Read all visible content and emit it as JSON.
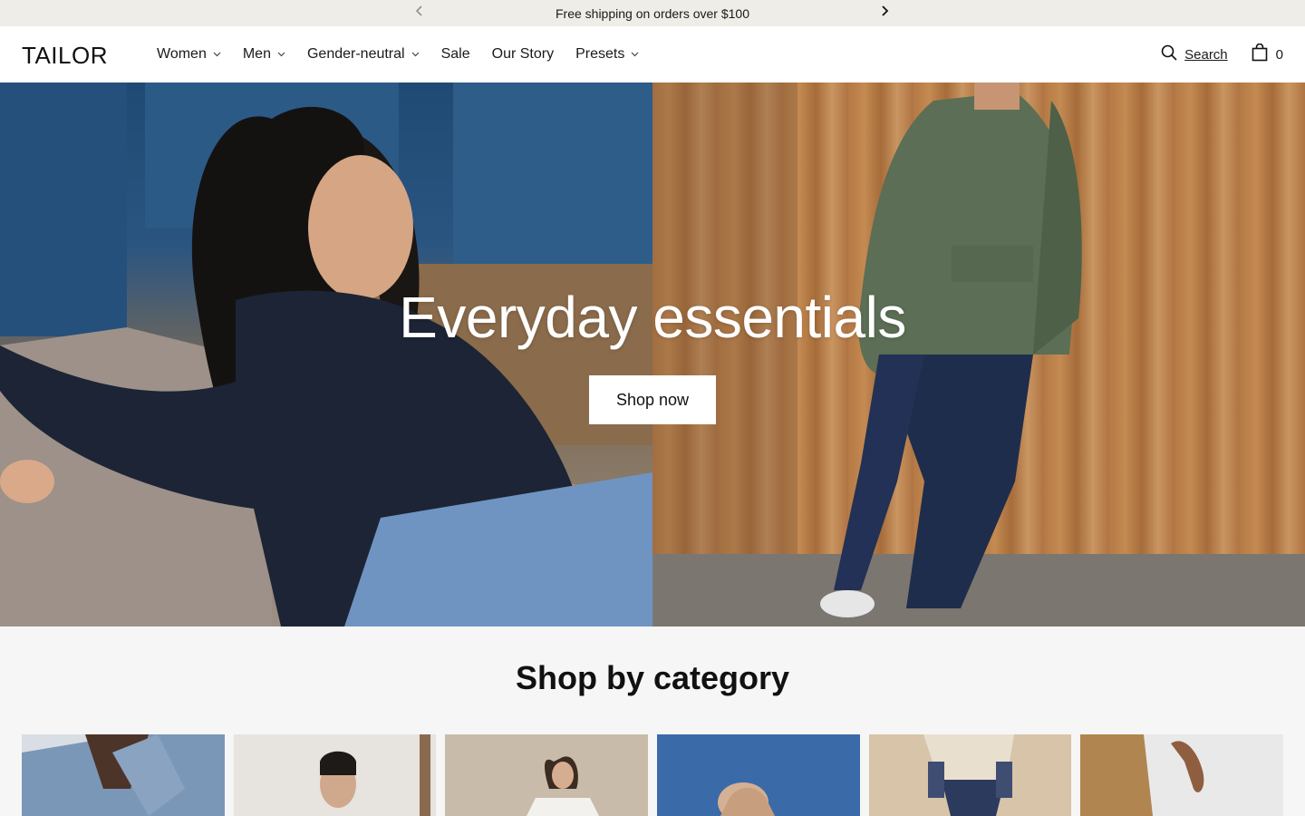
{
  "announcement": {
    "text": "Free shipping on orders over $100",
    "prev_icon": "chevron-left-icon",
    "next_icon": "chevron-right-icon"
  },
  "header": {
    "logo": "TAILOR",
    "nav": [
      {
        "label": "Women",
        "has_dropdown": true
      },
      {
        "label": "Men",
        "has_dropdown": true
      },
      {
        "label": "Gender-neutral",
        "has_dropdown": true
      },
      {
        "label": "Sale",
        "has_dropdown": false
      },
      {
        "label": "Our Story",
        "has_dropdown": false
      },
      {
        "label": "Presets",
        "has_dropdown": true
      }
    ],
    "search_label": "Search",
    "cart_count": "0"
  },
  "hero": {
    "title": "Everyday essentials",
    "button_label": "Shop now"
  },
  "category_section": {
    "title": "Shop by category"
  },
  "colors": {
    "announcement_bg": "#efede8",
    "header_bg": "#ffffff",
    "page_bg": "#f6f6f6",
    "text": "#1a1a1a"
  }
}
